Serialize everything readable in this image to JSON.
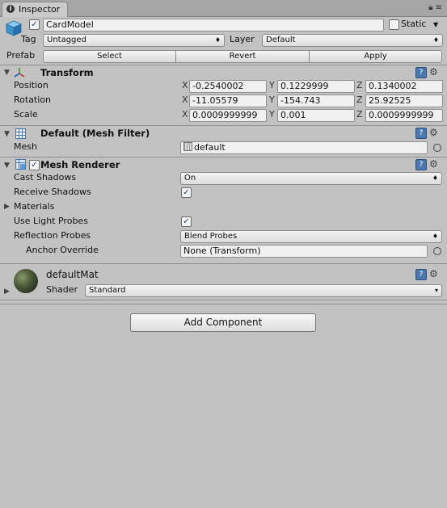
{
  "window": {
    "tab_label": "Inspector",
    "tab_icon": "info-icon"
  },
  "gameobject": {
    "active": true,
    "name": "CardModel",
    "static_label": "Static",
    "static_checked": false,
    "tag_label": "Tag",
    "tag_value": "Untagged",
    "layer_label": "Layer",
    "layer_value": "Default",
    "prefab_label": "Prefab",
    "prefab_select": "Select",
    "prefab_revert": "Revert",
    "prefab_apply": "Apply"
  },
  "transform": {
    "title": "Transform",
    "position_label": "Position",
    "rotation_label": "Rotation",
    "scale_label": "Scale",
    "x_label": "X",
    "y_label": "Y",
    "z_label": "Z",
    "position": {
      "x": "-0.2540002",
      "y": "0.1229999",
      "z": "0.1340002"
    },
    "rotation": {
      "x": "-11.05579",
      "y": "-154.743",
      "z": "25.92525"
    },
    "scale": {
      "x": "0.0009999999",
      "y": "0.001",
      "z": "0.0009999999"
    }
  },
  "mesh_filter": {
    "title": "Default (Mesh Filter)",
    "mesh_label": "Mesh",
    "mesh_value": "default"
  },
  "mesh_renderer": {
    "title": "Mesh Renderer",
    "enabled": true,
    "cast_shadows_label": "Cast Shadows",
    "cast_shadows_value": "On",
    "receive_shadows_label": "Receive Shadows",
    "receive_shadows": true,
    "materials_label": "Materials",
    "use_light_probes_label": "Use Light Probes",
    "use_light_probes": true,
    "reflection_probes_label": "Reflection Probes",
    "reflection_probes_value": "Blend Probes",
    "anchor_override_label": "Anchor Override",
    "anchor_override_value": "None (Transform)"
  },
  "material": {
    "name": "defaultMat",
    "shader_label": "Shader",
    "shader_value": "Standard"
  },
  "add_component_label": "Add Component",
  "colors": {
    "background": "#c2c2c2",
    "help_icon": "#4a78b0"
  }
}
